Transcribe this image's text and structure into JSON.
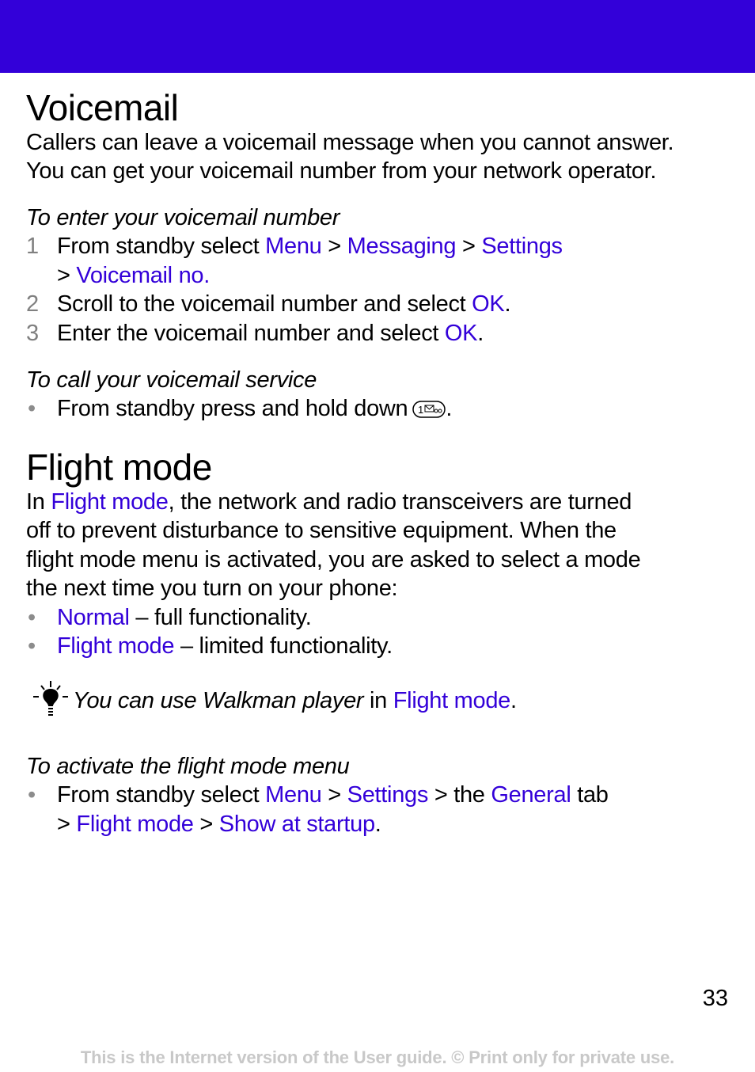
{
  "colors": {
    "accent": "#3300d9",
    "header_band": "#3300d9",
    "footer_text": "#c8c8c8",
    "number_gray": "#808080"
  },
  "voicemail": {
    "title": "Voicemail",
    "intro_line1": "Callers can leave a voicemail message when you cannot answer.",
    "intro_line2": "You can get your voicemail number from your network operator.",
    "enter_heading": "To enter your voicemail number",
    "steps": [
      {
        "num": "1",
        "t1": "From standby select ",
        "l1": "Menu",
        "t2": " > ",
        "l2": "Messaging",
        "t3": " > ",
        "l3": "Settings",
        "t4": "> ",
        "l4": "Voicemail no."
      },
      {
        "num": "2",
        "t1": "Scroll to the voicemail number and select ",
        "l1": "OK",
        "t2": "."
      },
      {
        "num": "3",
        "t1": "Enter the voicemail number and select ",
        "l1": "OK",
        "t2": "."
      }
    ],
    "call_heading": "To call your voicemail service",
    "call_bullet": {
      "t1": "From standby press and hold down",
      "key_icon": "key-1-voicemail-icon",
      "key_label": "1",
      "t2": "."
    }
  },
  "flight": {
    "title": "Flight mode",
    "p_t1": "In ",
    "p_l1": "Flight mode",
    "p_t2": ", the network and radio transceivers are turned",
    "p_line2": "off to prevent disturbance to sensitive equipment. When the",
    "p_line3": "flight mode menu is activated, you are asked to select a mode",
    "p_line4": "the next time you turn on your phone:",
    "options": [
      {
        "label": "Normal",
        "desc": " – full functionality."
      },
      {
        "label": "Flight mode",
        "desc": " – limited functionality."
      }
    ],
    "tip": {
      "icon": "lightbulb-icon",
      "t1": "You can use Walkman player",
      "t2": " in ",
      "l1": "Flight mode",
      "t3": "."
    },
    "activate_heading": "To activate the flight mode menu",
    "activate": {
      "t1": "From standby select ",
      "l1": "Menu",
      "t2": " > ",
      "l2": "Settings",
      "t3": " > the ",
      "l3": "General",
      "t4": " tab",
      "t5": "> ",
      "l4": "Flight mode",
      "t6": " > ",
      "l5": "Show at startup",
      "t7": "."
    }
  },
  "page_number": "33",
  "footer": "This is the Internet version of the User guide. © Print only for private use."
}
